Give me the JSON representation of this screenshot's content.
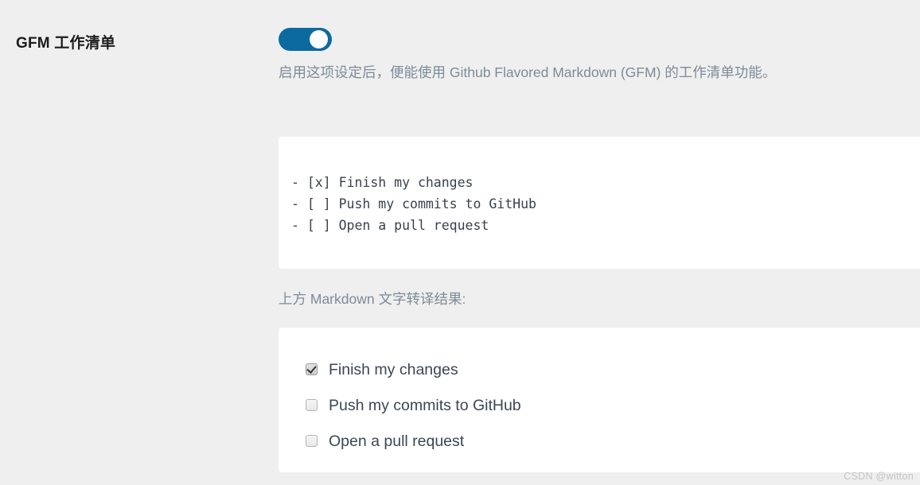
{
  "setting": {
    "label": "GFM 工作清单",
    "toggle": {
      "name": "gfm-task-list-toggle",
      "state": "on",
      "on_color": "#0d6aa0",
      "knob_color": "#ffffff"
    },
    "description": "启用这项设定后，便能使用 Github Flavored Markdown (GFM) 的工作清单功能。"
  },
  "code_sample": {
    "lines": [
      "- [x] Finish my changes",
      "- [ ] Push my commits to GitHub",
      "- [ ] Open a pull request"
    ],
    "text": "- [x] Finish my changes\n- [ ] Push my commits to GitHub\n- [ ] Open a pull request"
  },
  "caption": "上方 Markdown 文字转译结果:",
  "rendered_tasks": [
    {
      "label": "Finish my changes",
      "checked": true
    },
    {
      "label": "Push my commits to GitHub",
      "checked": false
    },
    {
      "label": "Open a pull request",
      "checked": false
    }
  ],
  "watermark": "CSDN @witton",
  "theme": {
    "page_background": "#efefef",
    "panel_background": "#ffffff",
    "label_color": "#1c1c1c",
    "muted_text": "#7e8b99",
    "code_text": "#39414d",
    "task_text": "#3c4655",
    "watermark_color": "#c4c4c4"
  }
}
